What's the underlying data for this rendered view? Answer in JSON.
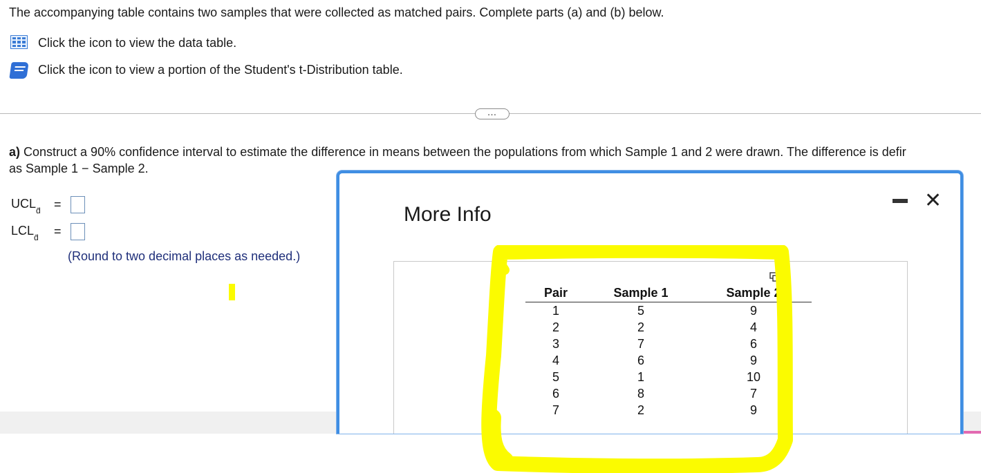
{
  "intro": "The accompanying table contains two samples that were collected as matched pairs. Complete parts (a) and (b) below.",
  "links": [
    {
      "icon": "data-table-icon",
      "label": "Click the icon to view the data table."
    },
    {
      "icon": "book-icon",
      "label": "Click the icon to view a portion of the Student's t-Distribution table."
    }
  ],
  "expand_button": "…",
  "question": {
    "part": "a)",
    "text": " Construct a 90% confidence interval to estimate the difference in means between the populations from which Sample 1 and 2 were drawn. The difference is defir",
    "text_line2": "as Sample 1 − Sample 2."
  },
  "answers": [
    {
      "label": "UCL",
      "sub": "d̄",
      "eq": "=",
      "value": ""
    },
    {
      "label": "LCL",
      "sub": "d̄",
      "eq": "=",
      "value": ""
    }
  ],
  "round_note": "(Round to two decimal places as needed.)",
  "dialog": {
    "title": "More Info",
    "minimize_icon": "minimize-icon",
    "close_icon": "close-icon",
    "table": {
      "headers": [
        "Pair",
        "Sample 1",
        "Sample 2"
      ],
      "rows": [
        [
          "1",
          "5",
          "9"
        ],
        [
          "2",
          "2",
          "4"
        ],
        [
          "3",
          "7",
          "6"
        ],
        [
          "4",
          "6",
          "9"
        ],
        [
          "5",
          "1",
          "10"
        ],
        [
          "6",
          "8",
          "7"
        ],
        [
          "7",
          "2",
          "9"
        ]
      ]
    }
  },
  "colors": {
    "accent": "#3f8ee3",
    "highlight": "#fbfb00",
    "note_text": "#1f2f7a"
  }
}
